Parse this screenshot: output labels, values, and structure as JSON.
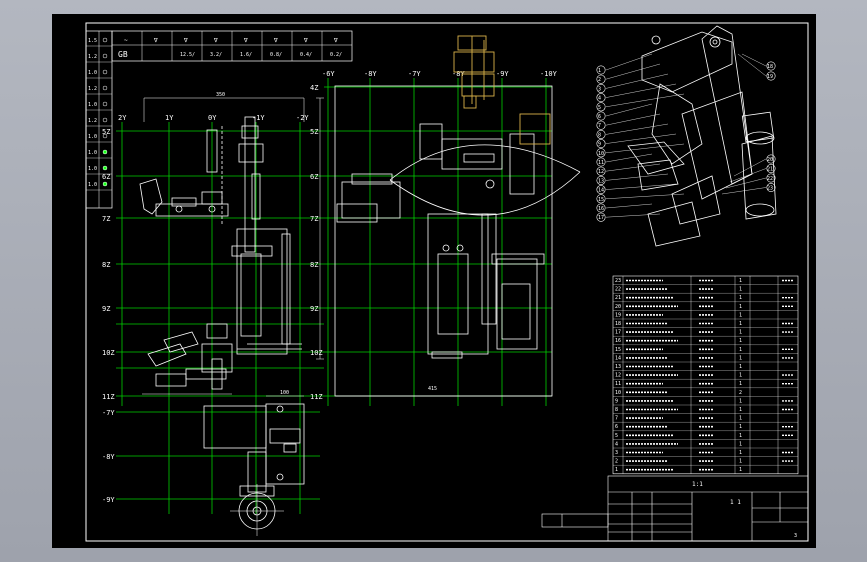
{
  "sheet": {
    "background": "#000000",
    "frame_color": "#ffffff",
    "grid_color": "#00d000",
    "accent_color": "#d9b24a"
  },
  "surface_table": {
    "standard": "GB",
    "symbols": [
      "~",
      "∇",
      "∇",
      "∇",
      "∇",
      "∇",
      "∇",
      "∇"
    ],
    "values": [
      "",
      "",
      "12.5/",
      "3.2/",
      "1.6/",
      "0.8/",
      "0.4/",
      "0.2/"
    ]
  },
  "side_markers": [
    "1.5",
    "1.2",
    "1.0",
    "1.2",
    "1.0",
    "1.2",
    "1.0",
    "1.0",
    "1.0",
    "1.0"
  ],
  "left_view": {
    "x_labels": [
      "2Y",
      "1Y",
      "0Y",
      "-1Y",
      "-2Y"
    ],
    "z_labels": [
      "5Z",
      "6Z",
      "7Z",
      "8Z",
      "9Z",
      "10Z",
      "11Z"
    ],
    "top_dim": "350"
  },
  "middle_view": {
    "x_labels": [
      "-6Y",
      "-8Y",
      "-7Y",
      "-8Y",
      "-9Y",
      "-10Y"
    ],
    "z_labels": [
      "4Z",
      "5Z",
      "6Z",
      "7Z",
      "8Z",
      "9Z",
      "10Z",
      "11Z"
    ],
    "bottom_dim": "415"
  },
  "lower_view": {
    "y_labels": [
      "-7Y",
      "-8Y",
      "-9Y"
    ],
    "top_dim": "100"
  },
  "balloons_left": [
    "1",
    "2",
    "3",
    "4",
    "5",
    "6",
    "7",
    "8",
    "9",
    "10",
    "11",
    "12",
    "13",
    "14",
    "15",
    "16",
    "17"
  ],
  "balloons_right": [
    "18",
    "19",
    "20",
    "21",
    "22",
    "23"
  ],
  "bom_rows": [
    [
      "23",
      "",
      "",
      "1",
      ""
    ],
    [
      "22",
      "",
      "",
      "1",
      ""
    ],
    [
      "21",
      "",
      "",
      "1",
      ""
    ],
    [
      "20",
      "",
      "",
      "1",
      ""
    ],
    [
      "19",
      "",
      "",
      "1",
      ""
    ],
    [
      "18",
      "",
      "",
      "1",
      ""
    ],
    [
      "17",
      "",
      "",
      "1",
      ""
    ],
    [
      "16",
      "",
      "",
      "1",
      ""
    ],
    [
      "15",
      "",
      "",
      "1",
      ""
    ],
    [
      "14",
      "",
      "",
      "1",
      ""
    ],
    [
      "13",
      "",
      "",
      "1",
      ""
    ],
    [
      "12",
      "",
      "",
      "1",
      ""
    ],
    [
      "11",
      "",
      "",
      "1",
      ""
    ],
    [
      "10",
      "",
      "",
      "2",
      ""
    ],
    [
      "9",
      "",
      "",
      "1",
      ""
    ],
    [
      "8",
      "",
      "",
      "1",
      ""
    ],
    [
      "7",
      "",
      "",
      "1",
      ""
    ],
    [
      "6",
      "",
      "",
      "1",
      ""
    ],
    [
      "5",
      "",
      "",
      "1",
      ""
    ],
    [
      "4",
      "",
      "",
      "1",
      ""
    ],
    [
      "3",
      "",
      "",
      "1",
      ""
    ],
    [
      "2",
      "",
      "",
      "1",
      ""
    ],
    [
      "1",
      "",
      "",
      "1",
      ""
    ]
  ],
  "title_block": {
    "scale": "1:1",
    "sheet_text": "1 1",
    "drawing_no": "",
    "project_no": ""
  },
  "corner_mark": "3"
}
